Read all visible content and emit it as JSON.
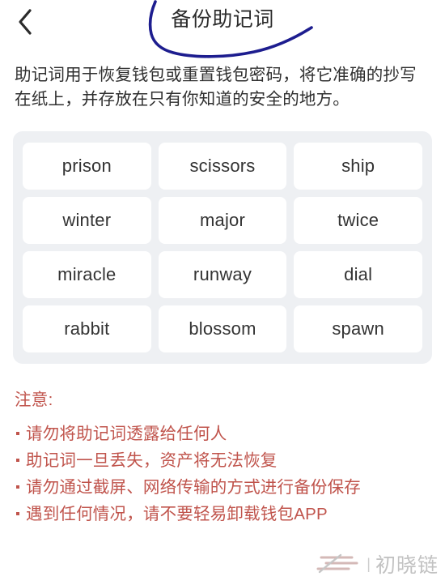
{
  "header": {
    "back_icon": "chevron-left-icon",
    "title": "备份助记词",
    "annotation_color": "#1d1d8f"
  },
  "description": "助记词用于恢复钱包或重置钱包密码，将它准确的抄写在纸上，并存放在只有你知道的安全的地方。",
  "mnemonic": {
    "panel_bg": "#eef0f3",
    "card_bg": "#ffffff",
    "words": [
      "prison",
      "scissors",
      "ship",
      "winter",
      "major",
      "twice",
      "miracle",
      "runway",
      "dial",
      "rabbit",
      "blossom",
      "spawn"
    ]
  },
  "warnings": {
    "color": "#c0544c",
    "title": "注意:",
    "items": [
      "请勿将助记词透露给任何人",
      "助记词一旦丢失，资产将无法恢复",
      "请勿通过截屏、网络传输的方式进行备份保存",
      "遇到任何情况，请不要轻易卸载钱包APP"
    ]
  },
  "watermark": {
    "logo_icon": "brand-logo-icon",
    "separator": "|",
    "text": "初晓链"
  }
}
